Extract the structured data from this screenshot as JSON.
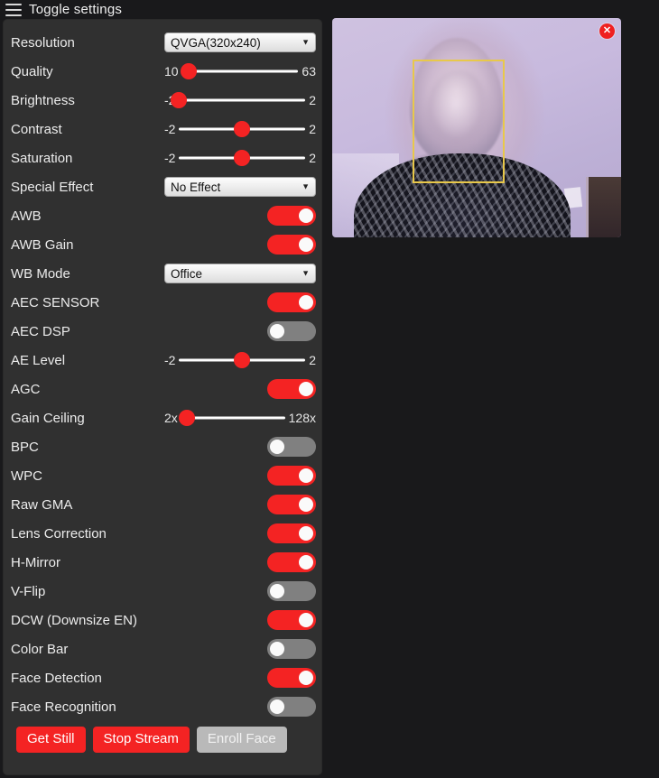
{
  "header": {
    "menu_icon": "hamburger-icon",
    "title": "Toggle settings"
  },
  "settings": {
    "rows": [
      {
        "label": "Resolution",
        "type": "select",
        "value": "QVGA(320x240)",
        "caret": "▼"
      },
      {
        "label": "Quality",
        "type": "slider",
        "min_label": "10",
        "max_label": "63",
        "position_pct": 6
      },
      {
        "label": "Brightness",
        "type": "slider",
        "min_label": "-2",
        "max_label": "2",
        "position_pct": 0
      },
      {
        "label": "Contrast",
        "type": "slider",
        "min_label": "-2",
        "max_label": "2",
        "position_pct": 50
      },
      {
        "label": "Saturation",
        "type": "slider",
        "min_label": "-2",
        "max_label": "2",
        "position_pct": 50
      },
      {
        "label": "Special Effect",
        "type": "select",
        "value": "No Effect",
        "caret": "▼"
      },
      {
        "label": "AWB",
        "type": "toggle",
        "state": "on"
      },
      {
        "label": "AWB Gain",
        "type": "toggle",
        "state": "on"
      },
      {
        "label": "WB Mode",
        "type": "select",
        "value": "Office",
        "caret": "▼"
      },
      {
        "label": "AEC SENSOR",
        "type": "toggle",
        "state": "on"
      },
      {
        "label": "AEC DSP",
        "type": "toggle",
        "state": "off"
      },
      {
        "label": "AE Level",
        "type": "slider",
        "min_label": "-2",
        "max_label": "2",
        "position_pct": 50
      },
      {
        "label": "AGC",
        "type": "toggle",
        "state": "on"
      },
      {
        "label": "Gain Ceiling",
        "type": "slider",
        "min_label": "2x",
        "max_label": "128x",
        "position_pct": 5
      },
      {
        "label": "BPC",
        "type": "toggle",
        "state": "off"
      },
      {
        "label": "WPC",
        "type": "toggle",
        "state": "on"
      },
      {
        "label": "Raw GMA",
        "type": "toggle",
        "state": "on"
      },
      {
        "label": "Lens Correction",
        "type": "toggle",
        "state": "on"
      },
      {
        "label": "H-Mirror",
        "type": "toggle",
        "state": "on"
      },
      {
        "label": "V-Flip",
        "type": "toggle",
        "state": "off"
      },
      {
        "label": "DCW (Downsize EN)",
        "type": "toggle",
        "state": "on"
      },
      {
        "label": "Color Bar",
        "type": "toggle",
        "state": "off"
      },
      {
        "label": "Face Detection",
        "type": "toggle",
        "state": "on"
      },
      {
        "label": "Face Recognition",
        "type": "toggle",
        "state": "off"
      }
    ],
    "buttons": [
      {
        "label": "Get Still",
        "style": "primary"
      },
      {
        "label": "Stop Stream",
        "style": "primary"
      },
      {
        "label": "Enroll Face",
        "style": "disabled"
      }
    ]
  },
  "stream": {
    "close_label": "✕",
    "face_box_color": "#e8c84a"
  },
  "colors": {
    "accent_red": "#f42323",
    "toggle_off": "#808080",
    "panel_bg": "#303030",
    "page_bg": "#19191b"
  }
}
